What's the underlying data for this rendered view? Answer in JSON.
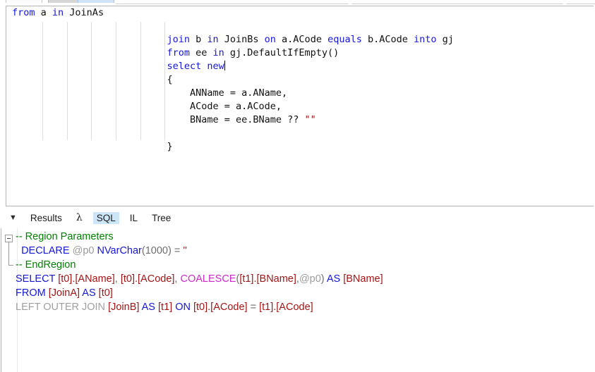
{
  "window": {
    "top_tabs": [
      "tab-1",
      "tab-2",
      "tab-3"
    ]
  },
  "editor": {
    "name": "csharp-linq-editor",
    "language": "C#",
    "caret_after": "new",
    "lines": [
      [
        {
          "t": "from",
          "c": "kw"
        },
        {
          "t": " a ",
          "c": "plain"
        },
        {
          "t": "in",
          "c": "kw"
        },
        {
          "t": " JoinAs",
          "c": "plain"
        }
      ],
      [],
      [
        {
          "t": "                           ",
          "c": "plain"
        },
        {
          "t": "join",
          "c": "kw"
        },
        {
          "t": " b ",
          "c": "plain"
        },
        {
          "t": "in",
          "c": "kw"
        },
        {
          "t": " JoinBs ",
          "c": "plain"
        },
        {
          "t": "on",
          "c": "kw"
        },
        {
          "t": " a.ACode ",
          "c": "plain"
        },
        {
          "t": "equals",
          "c": "kw"
        },
        {
          "t": " b.ACode ",
          "c": "plain"
        },
        {
          "t": "into",
          "c": "kw"
        },
        {
          "t": " gj",
          "c": "plain"
        }
      ],
      [
        {
          "t": "                           ",
          "c": "plain"
        },
        {
          "t": "from",
          "c": "kw"
        },
        {
          "t": " ee ",
          "c": "plain"
        },
        {
          "t": "in",
          "c": "kw"
        },
        {
          "t": " gj.DefaultIfEmpty()",
          "c": "plain"
        }
      ],
      [
        {
          "t": "                           ",
          "c": "plain"
        },
        {
          "t": "select",
          "c": "kw"
        },
        {
          "t": " ",
          "c": "plain"
        },
        {
          "t": "new",
          "c": "kw"
        },
        {
          "t": "",
          "c": "caret"
        }
      ],
      [
        {
          "t": "                           {",
          "c": "plain"
        }
      ],
      [
        {
          "t": "                               ANName = a.AName,",
          "c": "plain"
        }
      ],
      [
        {
          "t": "                               ACode = a.ACode,",
          "c": "plain"
        }
      ],
      [
        {
          "t": "                               BName = ee.BName ?? ",
          "c": "plain"
        },
        {
          "t": "\"\"",
          "c": "str"
        }
      ],
      [],
      [
        {
          "t": "                           }",
          "c": "plain"
        }
      ]
    ],
    "raw_text": "from a in JoinAs\n\n                           join b in JoinBs on a.ACode equals b.ACode into gj\n                           from ee in gj.DefaultIfEmpty()\n                           select new\n                           {\n                               AName = a.AName,\n                               ACode = a.ACode,\n                               BName = ee.BName ?? \"\"\n\n                           }",
    "indent_guide_x": [
      51,
      86,
      120,
      155,
      190,
      224
    ]
  },
  "tabstrip": {
    "toggle_icon": "triangle-down-icon",
    "tabs": [
      {
        "label": "Results",
        "selected": false
      },
      {
        "label": "λ",
        "selected": false
      },
      {
        "label": "SQL",
        "selected": true
      },
      {
        "label": "IL",
        "selected": false
      },
      {
        "label": "Tree",
        "selected": false
      }
    ],
    "selected_tab": "SQL",
    "selected_bg": "#cde6f7"
  },
  "sql_panel": {
    "name": "sql-output-pane",
    "region_collapsed": false,
    "lines": [
      [
        {
          "t": "-- Region Parameters",
          "c": "s-comment"
        }
      ],
      [
        {
          "t": "  ",
          "c": "s-op"
        },
        {
          "t": "DECLARE",
          "c": "s-kw"
        },
        {
          "t": " ",
          "c": "s-op"
        },
        {
          "t": "@p0",
          "c": "s-param"
        },
        {
          "t": " ",
          "c": "s-op"
        },
        {
          "t": "NVarChar",
          "c": "s-kw"
        },
        {
          "t": "(1000)",
          "c": "s-op"
        },
        {
          "t": " = ",
          "c": "s-op"
        },
        {
          "t": "''",
          "c": "s-str"
        }
      ],
      [
        {
          "t": "-- EndRegion",
          "c": "s-comment"
        }
      ],
      [
        {
          "t": "SELECT",
          "c": "s-kw"
        },
        {
          "t": " ",
          "c": "s-op"
        },
        {
          "t": "[t0].[AName]",
          "c": "s-ident"
        },
        {
          "t": ", ",
          "c": "s-op"
        },
        {
          "t": "[t0].[ACode]",
          "c": "s-ident"
        },
        {
          "t": ", ",
          "c": "s-op"
        },
        {
          "t": "COALESCE",
          "c": "s-func"
        },
        {
          "t": "(",
          "c": "s-op"
        },
        {
          "t": "[t1].[BName]",
          "c": "s-ident"
        },
        {
          "t": ",",
          "c": "s-op"
        },
        {
          "t": "@p0",
          "c": "s-param"
        },
        {
          "t": ") ",
          "c": "s-op"
        },
        {
          "t": "AS",
          "c": "s-kw"
        },
        {
          "t": " ",
          "c": "s-op"
        },
        {
          "t": "[BName]",
          "c": "s-ident"
        }
      ],
      [
        {
          "t": "FROM",
          "c": "s-kw"
        },
        {
          "t": " ",
          "c": "s-op"
        },
        {
          "t": "[JoinA]",
          "c": "s-ident"
        },
        {
          "t": " ",
          "c": "s-op"
        },
        {
          "t": "AS",
          "c": "s-kw"
        },
        {
          "t": " ",
          "c": "s-op"
        },
        {
          "t": "[t0]",
          "c": "s-ident"
        }
      ],
      [
        {
          "t": "LEFT OUTER JOIN",
          "c": "s-gray"
        },
        {
          "t": " ",
          "c": "s-op"
        },
        {
          "t": "[JoinB]",
          "c": "s-ident"
        },
        {
          "t": " ",
          "c": "s-op"
        },
        {
          "t": "AS",
          "c": "s-kw"
        },
        {
          "t": " ",
          "c": "s-op"
        },
        {
          "t": "[t1]",
          "c": "s-ident"
        },
        {
          "t": " ",
          "c": "s-op"
        },
        {
          "t": "ON",
          "c": "s-kw"
        },
        {
          "t": " ",
          "c": "s-op"
        },
        {
          "t": "[t0].[ACode]",
          "c": "s-ident"
        },
        {
          "t": " = ",
          "c": "s-op"
        },
        {
          "t": "[t1].[ACode]",
          "c": "s-ident"
        }
      ]
    ],
    "raw_text": "-- Region Parameters\n  DECLARE @p0 NVarChar(1000) = ''\n-- EndRegion\nSELECT [t0].[AName], [t0].[ACode], COALESCE([t1].[BName],@p0) AS [BName]\nFROM [JoinA] AS [t0]\nLEFT OUTER JOIN [JoinB] AS [t1] ON [t0].[ACode] = [t1].[ACode]"
  },
  "colors": {
    "keyword_blue": "#1616d6",
    "comment_green": "#008000",
    "identifier_red": "#a31515",
    "function_magenta": "#ca28c8",
    "parameter_gray": "#9b9b9b",
    "selected_tab_bg": "#cde6f7",
    "panel_border": "#b4b4b4",
    "indent_guide": "#dcdcdc"
  }
}
